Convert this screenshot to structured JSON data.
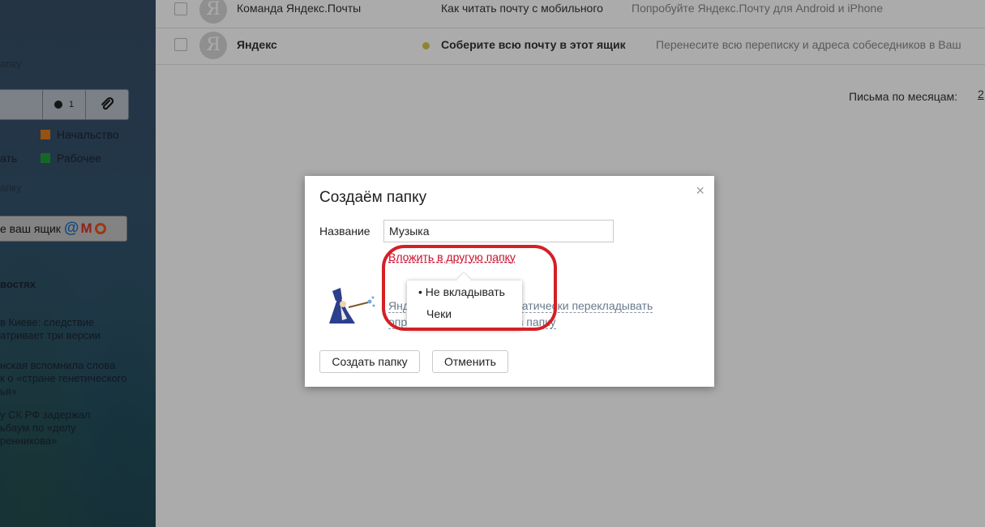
{
  "sidebar": {
    "folder_partial_1": "апку",
    "toolbar": {
      "dot_count": "1"
    },
    "labels": [
      {
        "name": "Начальство",
        "color": "#e07b1a"
      },
      {
        "name": "Рабочее",
        "color": "#1e9b3a"
      }
    ],
    "partial_text": "ать",
    "folder_partial_2": "апку",
    "collect_button": "е ваш ящик",
    "news_title": "востях",
    "news": [
      {
        "line1": "в Киеве: следствие",
        "line2": "атривает три версии"
      },
      {
        "line1": "нская вспомнила слова",
        "line2": "к о «стране генетического",
        "line3": "ья»"
      },
      {
        "line1": "у СК РФ задержал",
        "line2": "ьбаум по «делу",
        "line3": "ренникова»"
      }
    ]
  },
  "mail_list": [
    {
      "avatar": "Я",
      "sender": "Команда Яндекс.Почты",
      "subject": "Как читать почту с мобильного",
      "preview": "Попробуйте Яндекс.Почту для Android и iPhone",
      "bold": false
    },
    {
      "avatar": "Я",
      "sender": "Яндекс",
      "subject": "Соберите всю почту в этот ящик",
      "preview": "Перенесите всю переписку и адреса собеседников в Ваш",
      "bold": true
    }
  ],
  "months": {
    "label": "Письма по месяцам:",
    "year": "2"
  },
  "dialog": {
    "title": "Создаём папку",
    "close": "×",
    "name_label": "Название",
    "name_value": "Музыка",
    "nest_link": "Вложить в другую папку",
    "auto_line1": "Янд",
    "auto_line1_end": "втоматически перекладывать",
    "auto_line2": "опре",
    "auto_line2_end": "в папку",
    "create_button": "Создать папку",
    "cancel_button": "Отменить"
  },
  "nest_dropdown": {
    "options": [
      {
        "label": "Не вкладывать",
        "selected": true
      },
      {
        "label": "Чеки",
        "selected": false
      }
    ]
  }
}
